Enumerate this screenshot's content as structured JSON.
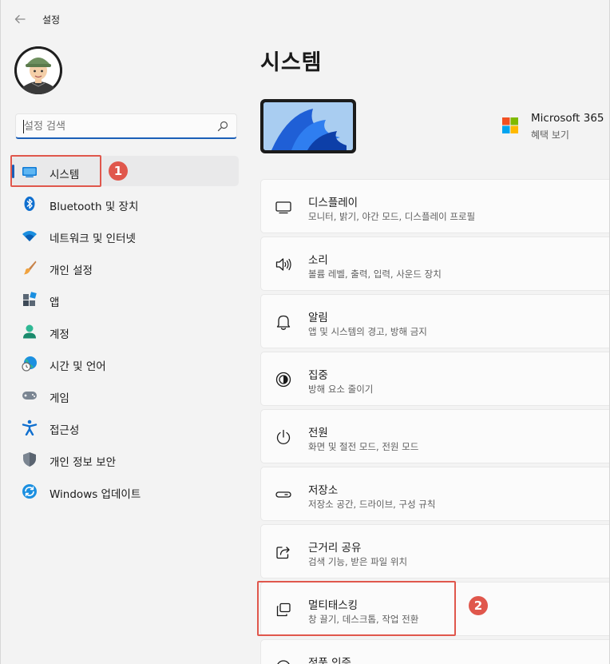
{
  "window": {
    "app_title": "설정",
    "back_icon": "arrow-left-icon"
  },
  "sidebar": {
    "search": {
      "placeholder": "설정 검색",
      "value": ""
    },
    "items": [
      {
        "label": "시스템",
        "icon": "system-monitor-icon",
        "active": true
      },
      {
        "label": "Bluetooth 및 장치",
        "icon": "bluetooth-icon"
      },
      {
        "label": "네트워크 및 인터넷",
        "icon": "wifi-icon"
      },
      {
        "label": "개인 설정",
        "icon": "paintbrush-icon"
      },
      {
        "label": "앱",
        "icon": "apps-icon"
      },
      {
        "label": "계정",
        "icon": "account-person-icon"
      },
      {
        "label": "시간 및 언어",
        "icon": "time-language-globe-icon"
      },
      {
        "label": "게임",
        "icon": "gamepad-icon"
      },
      {
        "label": "접근성",
        "icon": "accessibility-icon"
      },
      {
        "label": "개인 정보 보안",
        "icon": "shield-icon"
      },
      {
        "label": "Windows 업데이트",
        "icon": "windows-update-icon"
      }
    ]
  },
  "annotations": {
    "badge_1": "1",
    "badge_2": "2",
    "color": "#e0574c"
  },
  "main": {
    "page_title": "시스템",
    "promo": {
      "title": "Microsoft 365",
      "subtitle": "혜택 보기"
    },
    "settings": [
      {
        "title": "디스플레이",
        "subtitle": "모니터, 밝기, 야간 모드, 디스플레이 프로필",
        "icon": "display-icon"
      },
      {
        "title": "소리",
        "subtitle": "볼륨 레벨, 출력, 입력, 사운드 장치",
        "icon": "speaker-icon"
      },
      {
        "title": "알림",
        "subtitle": "앱 및 시스템의 경고, 방해 금지",
        "icon": "bell-icon"
      },
      {
        "title": "집중",
        "subtitle": "방해 요소 줄이기",
        "icon": "focus-icon"
      },
      {
        "title": "전원",
        "subtitle": "화면 및 절전 모드, 전원 모드",
        "icon": "power-icon"
      },
      {
        "title": "저장소",
        "subtitle": "저장소 공간, 드라이브, 구성 규칙",
        "icon": "storage-drive-icon"
      },
      {
        "title": "근거리 공유",
        "subtitle": "검색 기능, 받은 파일 위치",
        "icon": "share-icon"
      },
      {
        "title": "멀티태스킹",
        "subtitle": "창 끌기, 데스크톱, 작업 전환",
        "icon": "multitasking-icon"
      },
      {
        "title": "정품 인증",
        "subtitle": "",
        "icon": "activation-icon"
      }
    ]
  },
  "colors": {
    "accent": "#1b5fb8",
    "background": "#f3f3f3",
    "card": "#fbfbfb"
  }
}
